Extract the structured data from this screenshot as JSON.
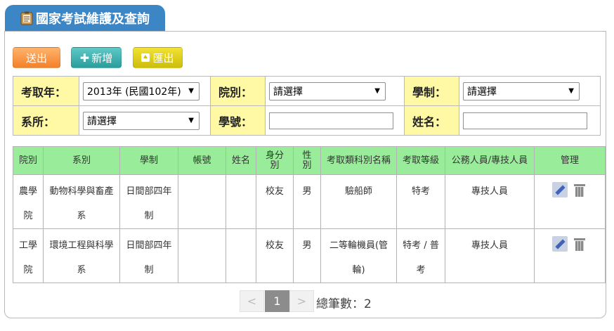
{
  "header": {
    "title": "國家考試維護及查詢",
    "icon": "clipboard-icon"
  },
  "toolbar": {
    "send_label": "送出",
    "add_label": "新增",
    "export_label": "匯出"
  },
  "filters": {
    "year_label": "考取年：",
    "year_value": "2013年 (民國102年)",
    "college_label": "院別：",
    "college_value": "請選擇",
    "system_label": "學制：",
    "system_value": "請選擇",
    "dept_label": "系所：",
    "dept_value": "請選擇",
    "student_id_label": "學號：",
    "student_id_value": "",
    "name_label": "姓名：",
    "name_value": ""
  },
  "table": {
    "headers": [
      "院別",
      "系別",
      "學制",
      "帳號",
      "姓名",
      "身分別",
      "性別",
      "考取類科別名稱",
      "考取等級",
      "公務人員/專技人員",
      "管理"
    ],
    "rows": [
      {
        "college": "農學院",
        "dept": "動物科學與畜產系",
        "system": "日間部四年制",
        "account": "",
        "name": "",
        "identity": "校友",
        "gender": "男",
        "category": "驗船師",
        "level": "特考",
        "type": "專技人員"
      },
      {
        "college": "工學院",
        "dept": "環境工程與科學系",
        "system": "日間部四年制",
        "account": "",
        "name": "",
        "identity": "校友",
        "gender": "男",
        "category": "二等輪機員(管輪)",
        "level": "特考 / 普考",
        "type": "專技人員"
      }
    ]
  },
  "pagination": {
    "prev": "<",
    "current": "1",
    "next": ">",
    "total_label": "總筆數：2"
  },
  "colors": {
    "header_tab": "#3d86c6",
    "filter_label_bg": "#fff9a6",
    "table_header_bg": "#99ec99"
  }
}
